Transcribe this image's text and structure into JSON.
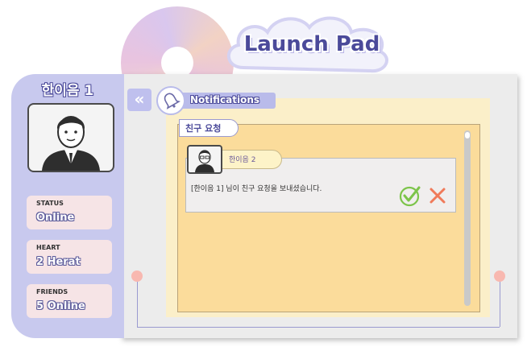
{
  "app": {
    "title": "Launch Pad"
  },
  "sidebar": {
    "username": "한이음 1",
    "stats": [
      {
        "label": "STATUS",
        "value": "Online"
      },
      {
        "label": "HEART",
        "value": "2 Herat"
      },
      {
        "label": "FRIENDS",
        "value": "5 Online"
      }
    ]
  },
  "header": {
    "collapse_icon": "double-chevron-left",
    "notifications_label": "Notifications",
    "notifications_icon": "bell-icon"
  },
  "section": {
    "title": "친구 요청"
  },
  "request": {
    "name": "한이음 2",
    "message": "[한이음 1] 님이 친구 요청을 보내셨습니다.",
    "accept_icon": "check-circle",
    "reject_icon": "x-mark"
  },
  "colors": {
    "accent": "#4b4a9a",
    "sidebar": "#c8c9ee",
    "panel": "#fbdc9b",
    "accept": "#7cc44a",
    "reject": "#f07a5a"
  }
}
